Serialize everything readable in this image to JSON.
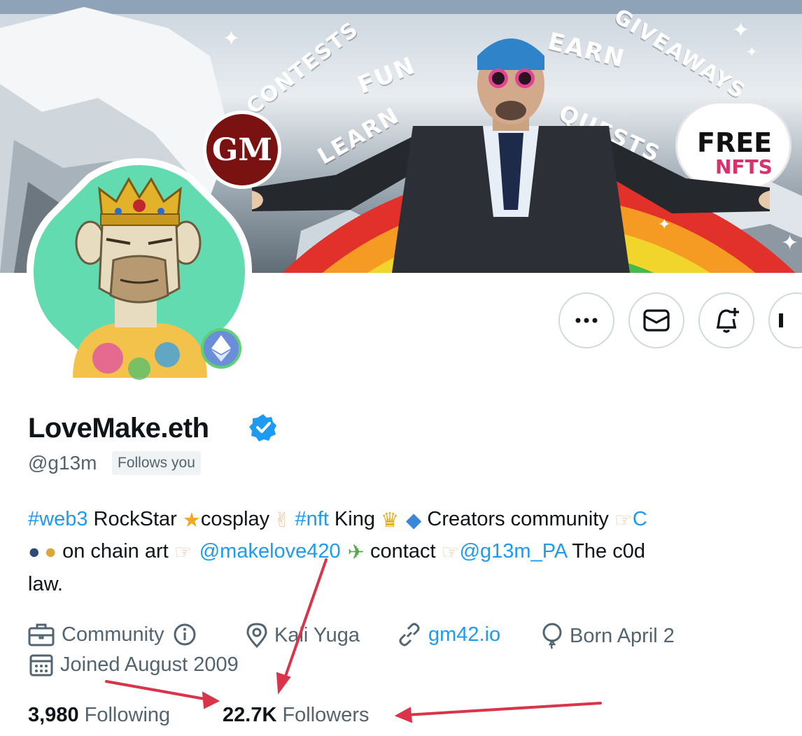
{
  "banner": {
    "rainbow_words": {
      "contests": "CONTESTS",
      "fun": "FUN",
      "learn": "LEARN",
      "earn": "EARN",
      "quests": "QUESTS",
      "giveaways": "GIVEAWAYS"
    },
    "badge_text": "GM",
    "cloud_line1": "FREE",
    "cloud_line2": "NFTS"
  },
  "profile": {
    "display_name": "LoveMake.eth",
    "handle": "@g13m",
    "follows_you": "Follows you",
    "verified_color": "#1d9bf0"
  },
  "bio": {
    "line1": {
      "tag_web3": "#web3",
      "t1": " RockStar ",
      "t2": "cosplay",
      "tag_nft": "#nft",
      "t3": " King ",
      "t4": " Creators community "
    },
    "line2": {
      "t1": " on chain art ",
      "mention1": "@makelove420",
      "t2": " contact ",
      "mention2": "@g13m_PA",
      "t3": " The c0d"
    },
    "line3": "law."
  },
  "meta": {
    "category": "Community",
    "location": "Kali Yuga",
    "website": "gm42.io",
    "birthday": "Born April 2",
    "joined": "Joined August 2009"
  },
  "stats": {
    "following_count": "3,980",
    "following_label": "Following",
    "followers_count": "22.7K",
    "followers_label": "Followers"
  },
  "icons": [
    "more-icon",
    "message-icon",
    "notification-bell-icon",
    "briefcase-icon",
    "info-icon",
    "location-pin-icon",
    "link-icon",
    "balloon-icon",
    "calendar-icon",
    "verified-icon",
    "ethereum-icon"
  ],
  "colors": {
    "link": "#1d9bf0",
    "secondary_text": "#536471",
    "annotation_arrow": "#d9344a",
    "avatar_bg": "#63dbb0"
  }
}
